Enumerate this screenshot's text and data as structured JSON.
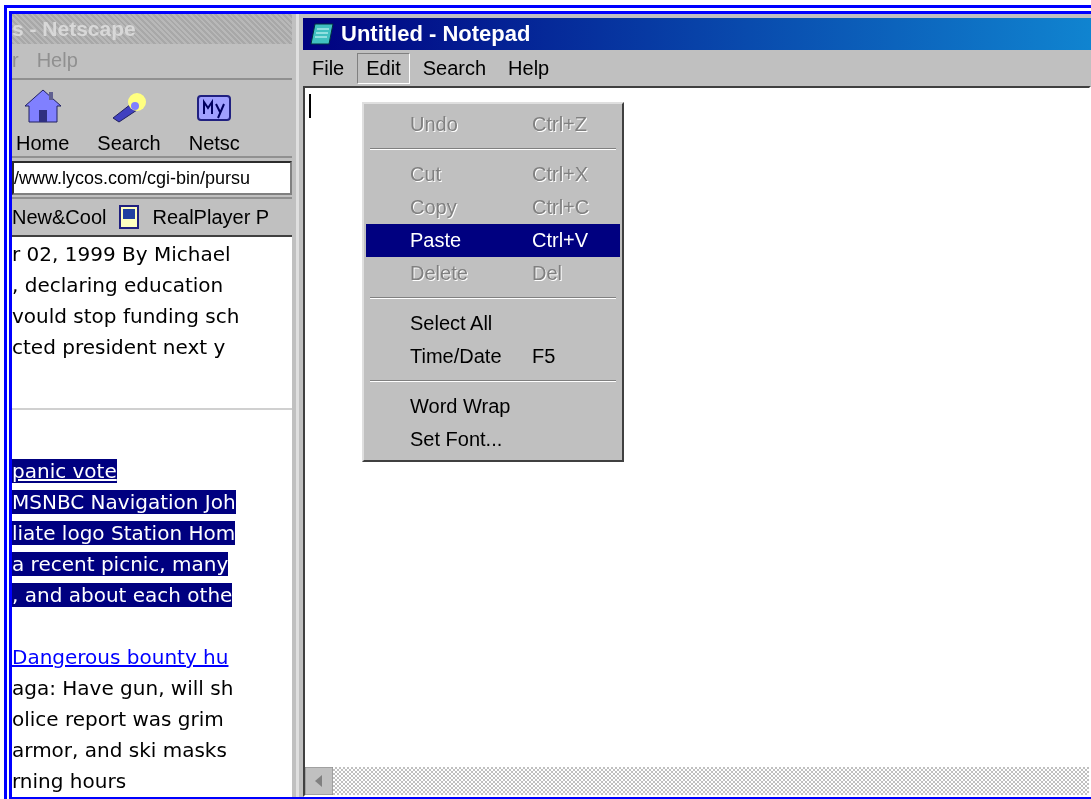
{
  "browser": {
    "title": "s - Netscape",
    "menu": [
      "r",
      "Help"
    ],
    "toolbar": [
      {
        "label": "Home",
        "kind": "home"
      },
      {
        "label": "Search",
        "kind": "search"
      },
      {
        "label": "Netsc",
        "kind": "my"
      }
    ],
    "location": "/www.lycos.com/cgi-bin/pursu",
    "personal": [
      {
        "label": "New&Cool",
        "kind": "plain"
      },
      {
        "label": "RealPlayer P",
        "kind": "doc"
      }
    ],
    "lines": [
      {
        "text": "r 02, 1999 By Michael",
        "kind": "text",
        "selected": false
      },
      {
        "text": ", declaring education",
        "kind": "text",
        "selected": false
      },
      {
        "text": "vould stop funding sch",
        "kind": "text",
        "selected": false
      },
      {
        "text": "cted president next y",
        "kind": "text",
        "selected": false
      },
      {
        "kind": "gap"
      },
      {
        "kind": "rule"
      },
      {
        "kind": "gap"
      },
      {
        "text": "panic vote",
        "kind": "link",
        "selected": true
      },
      {
        "text": "MSNBC Navigation Joh",
        "kind": "text",
        "selected": true
      },
      {
        "text": "liate logo Station Hom",
        "kind": "text",
        "selected": true
      },
      {
        "text": "a recent picnic, many",
        "kind": "text",
        "selected": true
      },
      {
        "text": ", and about each othe",
        "kind": "text",
        "selected": true
      },
      {
        "kind": "gap"
      },
      {
        "text": " Dangerous bounty hu",
        "kind": "link",
        "selected": false
      },
      {
        "text": "aga: Have gun, will sh",
        "kind": "text",
        "selected": false
      },
      {
        "text": "olice report was grim",
        "kind": "text",
        "selected": false
      },
      {
        "text": " armor, and ski masks",
        "kind": "text",
        "selected": false
      },
      {
        "text": "rning hours",
        "kind": "text",
        "selected": false
      }
    ]
  },
  "notepad": {
    "title": "Untitled - Notepad",
    "menu": [
      {
        "label": "File",
        "selected": false
      },
      {
        "label": "Edit",
        "selected": true
      },
      {
        "label": "Search",
        "selected": false
      },
      {
        "label": "Help",
        "selected": false
      }
    ],
    "edit_menu": [
      {
        "kind": "item",
        "label": "Undo",
        "shortcut": "Ctrl+Z",
        "disabled": true,
        "selected": false
      },
      {
        "kind": "separator"
      },
      {
        "kind": "item",
        "label": "Cut",
        "shortcut": "Ctrl+X",
        "disabled": true,
        "selected": false
      },
      {
        "kind": "item",
        "label": "Copy",
        "shortcut": "Ctrl+C",
        "disabled": true,
        "selected": false
      },
      {
        "kind": "item",
        "label": "Paste",
        "shortcut": "Ctrl+V",
        "disabled": false,
        "selected": true
      },
      {
        "kind": "item",
        "label": "Delete",
        "shortcut": "Del",
        "disabled": true,
        "selected": false
      },
      {
        "kind": "separator"
      },
      {
        "kind": "item",
        "label": "Select All",
        "disabled": false,
        "selected": false
      },
      {
        "kind": "item",
        "label": "Time/Date",
        "shortcut": "F5",
        "disabled": false,
        "selected": false
      },
      {
        "kind": "separator"
      },
      {
        "kind": "item",
        "label": "Word Wrap",
        "disabled": false,
        "selected": false
      },
      {
        "kind": "item",
        "label": "Set Font...",
        "disabled": false,
        "selected": false
      }
    ]
  }
}
